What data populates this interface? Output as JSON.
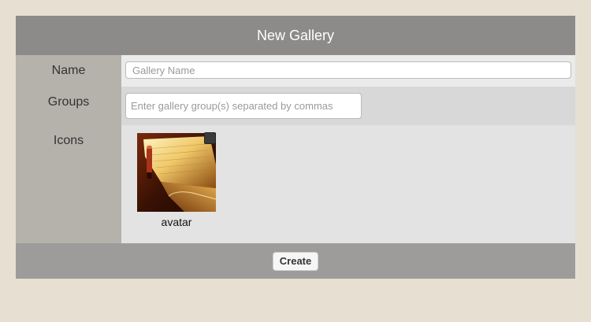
{
  "header": {
    "title": "New Gallery"
  },
  "form": {
    "name": {
      "label": "Name",
      "value": "",
      "placeholder": "Gallery Name"
    },
    "groups": {
      "label": "Groups",
      "value": "",
      "placeholder": "Enter gallery group(s) separated by commas"
    },
    "icons": {
      "label": "Icons",
      "items": [
        {
          "caption": "avatar",
          "image": "book-photo",
          "selected": false
        }
      ]
    }
  },
  "footer": {
    "create_label": "Create"
  },
  "colors": {
    "page_bg": "#e6dfd2",
    "header_bg": "#8d8a8a",
    "label_col_bg": "#b5b2ab",
    "footer_bg": "#9e9c9b"
  }
}
